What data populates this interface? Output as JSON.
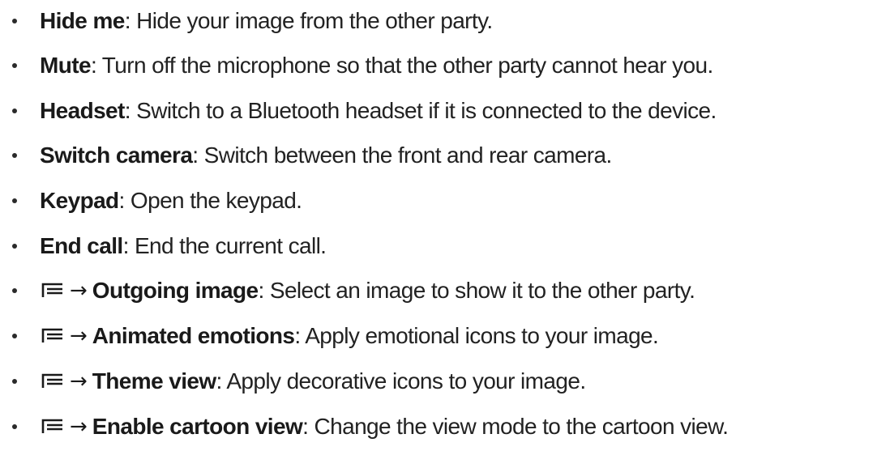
{
  "items": [
    {
      "term": "Hide me",
      "sep": ":",
      "desc": " Hide your image from the other party."
    },
    {
      "term": "Mute",
      "sep": ":",
      "desc": " Turn off the microphone so that the other party cannot hear you."
    },
    {
      "term": "Headset",
      "sep": ":",
      "desc": " Switch to a Bluetooth headset if it is connected to the device."
    },
    {
      "term": "Switch camera",
      "sep": ":",
      "desc": " Switch between the front and rear camera."
    },
    {
      "term": "Keypad",
      "sep": ":",
      "desc": " Open the keypad."
    },
    {
      "term": "End call",
      "sep": ":",
      "desc": " End the current call."
    },
    {
      "icon": "menu-icon",
      "arrow": "→",
      "term": "Outgoing image",
      "sep": ":",
      "desc": " Select an image to show it to the other party."
    },
    {
      "icon": "menu-icon",
      "arrow": "→",
      "term": "Animated emotions",
      "sep": ":",
      "desc": " Apply emotional icons to your image."
    },
    {
      "icon": "menu-icon",
      "arrow": "→",
      "term": "Theme view",
      "sep": ":",
      "desc": " Apply decorative icons to your image."
    },
    {
      "icon": "menu-icon",
      "arrow": "→",
      "term": "Enable cartoon view",
      "sep": ":",
      "desc": " Change the view mode to the cartoon view."
    }
  ]
}
